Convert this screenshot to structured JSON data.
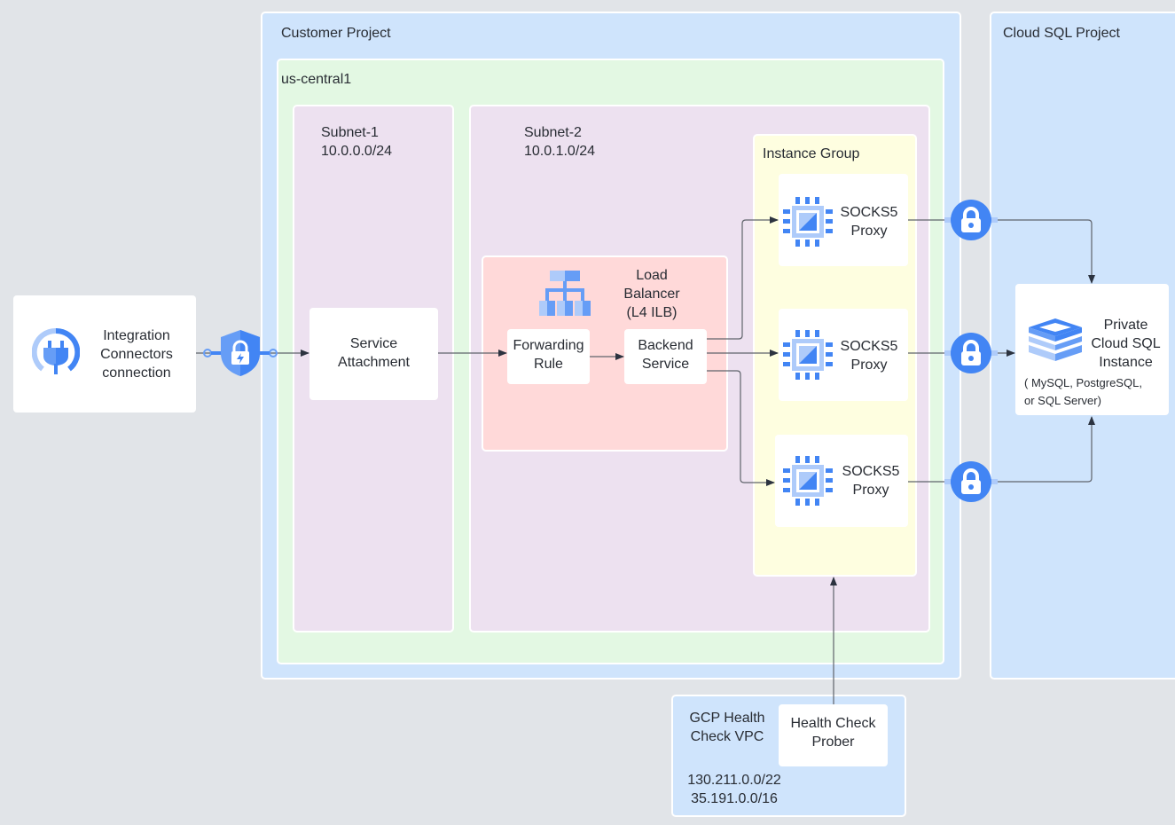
{
  "diagram": {
    "external": {
      "integration_connectors": {
        "line1": "Integration",
        "line2": "Connectors",
        "line3": "connection",
        "icon": "plug-icon"
      },
      "psc_icon": "shield-lock-icon"
    },
    "customer_project": {
      "title": "Customer Project",
      "region": {
        "title": "us-central1",
        "subnet1": {
          "name": "Subnet-1",
          "cidr": "10.0.0.0/24",
          "service_attachment": {
            "line1": "Service",
            "line2": "Attachment"
          }
        },
        "subnet2": {
          "name": "Subnet-2",
          "cidr": "10.0.1.0/24",
          "load_balancer": {
            "line1": "Load",
            "line2": "Balancer",
            "line3": "(L4 ILB)",
            "icon": "load-balancer-icon",
            "forwarding_rule": {
              "line1": "Forwarding",
              "line2": "Rule"
            },
            "backend_service": {
              "line1": "Backend",
              "line2": "Service"
            }
          },
          "instance_group": {
            "title": "Instance Group",
            "proxies": [
              {
                "line1": "SOCKS5",
                "line2": "Proxy",
                "icon": "compute-engine-icon"
              },
              {
                "line1": "SOCKS5",
                "line2": "Proxy",
                "icon": "compute-engine-icon"
              },
              {
                "line1": "SOCKS5",
                "line2": "Proxy",
                "icon": "compute-engine-icon"
              }
            ]
          }
        }
      }
    },
    "cloud_sql_project": {
      "title": "Cloud SQL Project",
      "instance": {
        "line1": "Private",
        "line2": "Cloud SQL",
        "line3": "Instance",
        "note1": "( MySQL, PostgreSQL,",
        "note2": "or SQL Server)",
        "icon": "cloud-sql-icon"
      },
      "lock_icon": "lock-icon"
    },
    "health_check": {
      "vpc_line1": "GCP Health",
      "vpc_line2": "Check VPC",
      "range1": "130.211.0.0/22",
      "range2": "35.191.0.0/16",
      "prober": {
        "line1": "Health Check",
        "line2": "Prober"
      }
    },
    "colors": {
      "project_blue": "#cfe4fc",
      "region_green": "#e3f8e3",
      "subnet_purple": "#ede1f0",
      "lb_red": "#ffd9d9",
      "instance_yellow": "#fefee0",
      "google_blue": "#4285f4",
      "light_blue": "#aecbfa",
      "wire": "#5f636b"
    }
  }
}
